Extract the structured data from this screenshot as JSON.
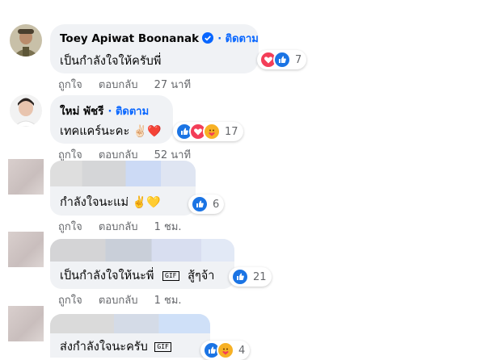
{
  "comments": [
    {
      "name": "Toey Apiwat Boonanak",
      "follow": "· ติดตาม",
      "text": "เป็นกำลังใจให้ครับพี่",
      "emoji": "",
      "reactions": [
        "heart-icon",
        "like-icon"
      ],
      "count": "7",
      "like": "ถูกใจ",
      "reply": "ตอบกลับ",
      "time": "27 นาที"
    },
    {
      "name": "ใหม่ พัชรี",
      "follow": "· ติดตาม",
      "text": "เทคแคร์นะคะ",
      "emoji": "✌🏻❤️",
      "reactions": [
        "like-icon",
        "heart-icon",
        "care-icon"
      ],
      "count": "17",
      "like": "ถูกใจ",
      "reply": "ตอบกลับ",
      "time": "52 นาที"
    },
    {
      "name": "",
      "text": "กำลังใจนะแม่",
      "emoji": "✌️💛",
      "reactions": [
        "like-icon"
      ],
      "count": "6",
      "like": "ถูกใจ",
      "reply": "ตอบกลับ",
      "time": "1 ชม."
    },
    {
      "name": "",
      "text": "เป็นกำลังใจให้นะพี่",
      "gif": "GIF",
      "tail": "สู้ๆจ้า",
      "reactions": [
        "like-icon"
      ],
      "count": "21",
      "like": "ถูกใจ",
      "reply": "ตอบกลับ",
      "time": "1 ชม."
    },
    {
      "name": "",
      "text": "ส่งกำลังใจนะครับ",
      "gif": "GIF",
      "reactions": [
        "like-icon",
        "care-icon"
      ],
      "count": "4"
    }
  ],
  "colors": {
    "accent": "#0866ff",
    "bubble": "#f0f2f5",
    "meta": "#65676b"
  }
}
